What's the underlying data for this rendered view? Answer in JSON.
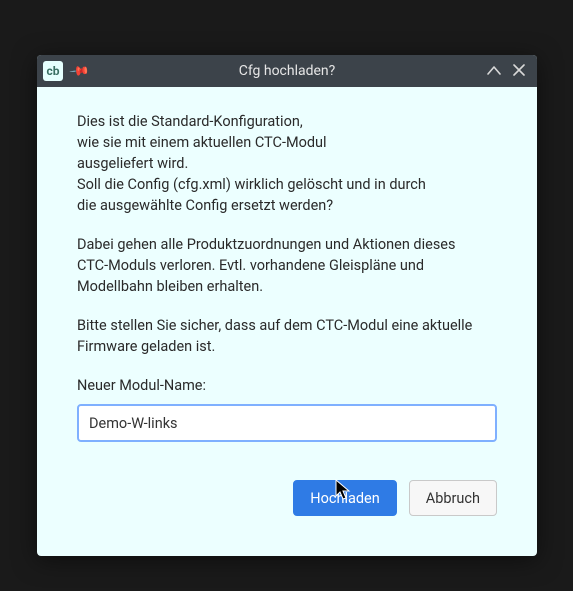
{
  "window": {
    "title": "Cfg hochladen?",
    "app_icon_text": "cb"
  },
  "dialog": {
    "para1_line1": "Dies ist die Standard-Konfiguration,",
    "para1_line2": "wie sie mit einem aktuellen CTC-Modul",
    "para1_line3": "ausgeliefert wird.",
    "para1_line4": "Soll die Config (cfg.xml) wirklich gelöscht und in durch",
    "para1_line5": "die ausgewählte Config ersetzt werden?",
    "para2_line1": "Dabei gehen alle Produktzuordnungen und Aktionen dieses",
    "para2_line2": "CTC-Moduls verloren. Evtl. vorhandene Gleispläne und",
    "para2_line3": "Modellbahn bleiben erhalten.",
    "para3_line1": "Bitte stellen Sie sicher, dass auf dem CTC-Modul eine aktuelle",
    "para3_line2": "Firmware geladen ist.",
    "label": "Neuer Modul-Name:",
    "input_value": "Demo-W-links",
    "primary_button": "Hochladen",
    "secondary_button": "Abbruch"
  }
}
